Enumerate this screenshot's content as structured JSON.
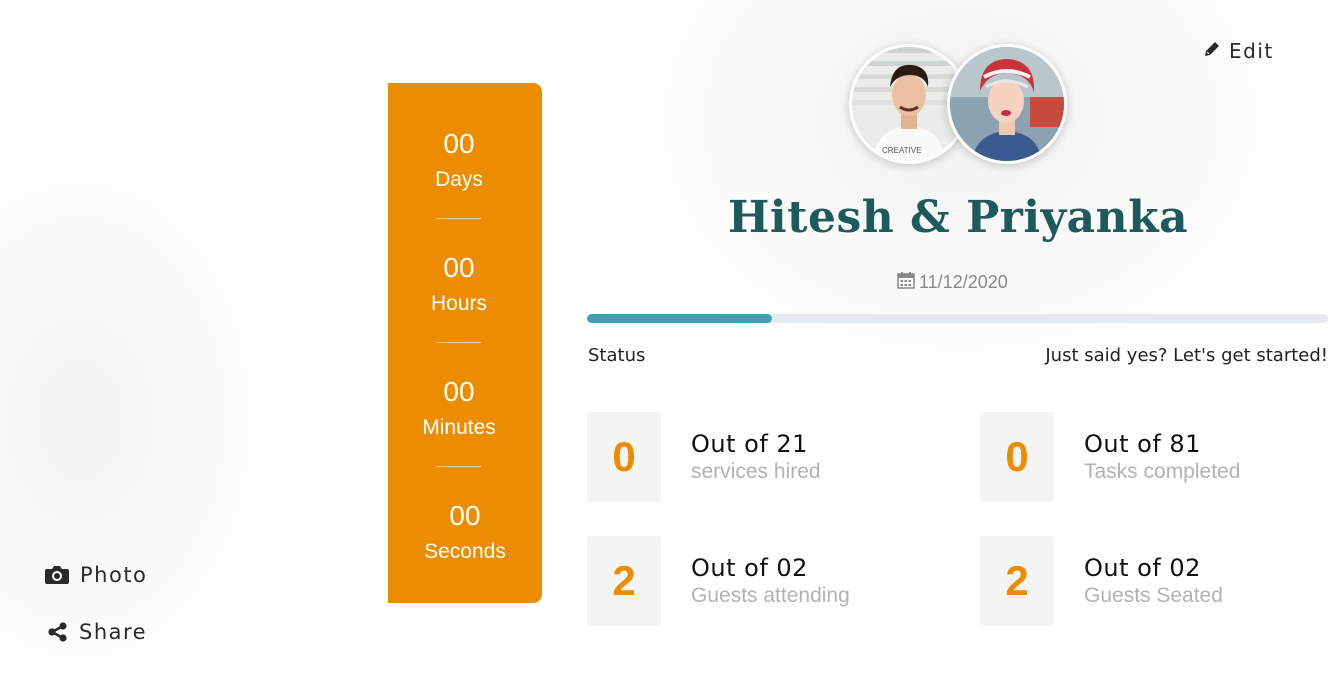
{
  "actions": {
    "photo_label": "Photo",
    "share_label": "Share"
  },
  "countdown": {
    "days": {
      "value": "00",
      "label": "Days"
    },
    "hours": {
      "value": "00",
      "label": "Hours"
    },
    "minutes": {
      "value": "00",
      "label": "Minutes"
    },
    "seconds": {
      "value": "00",
      "label": "Seconds"
    },
    "color": "#ec8c00"
  },
  "edit_label": "Edit",
  "couple": {
    "title": "Hitesh & Priyanka",
    "date": "11/12/2020",
    "shirt_text": "CREATIVE"
  },
  "progress": {
    "fraction": 0.25,
    "status_label": "Status",
    "message": "Just said yes? Let's get started!"
  },
  "stats": [
    {
      "value": "0",
      "main": "Out of 21",
      "sub": "services hired"
    },
    {
      "value": "0",
      "main": "Out of 81",
      "sub": "Tasks completed"
    },
    {
      "value": "2",
      "main": "Out of 02",
      "sub": "Guests attending"
    },
    {
      "value": "2",
      "main": "Out of 02",
      "sub": "Guests Seated"
    }
  ],
  "colors": {
    "accent": "#ec8c00",
    "title": "#1d5a5e",
    "progress": "#3aa3b5"
  },
  "icons": [
    "camera-icon",
    "share-icon",
    "pencil-icon",
    "calendar-icon"
  ]
}
